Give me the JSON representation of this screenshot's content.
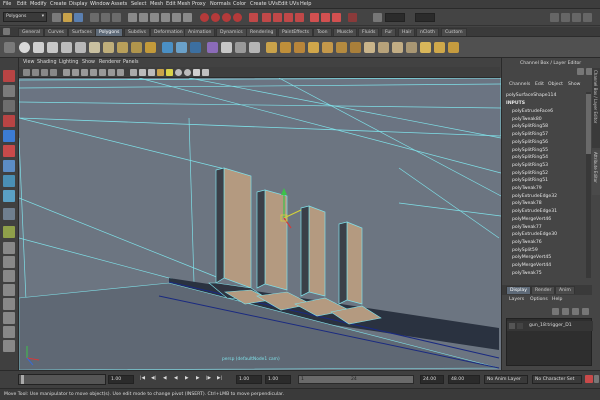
{
  "menubar": {
    "items": [
      "File",
      "Edit",
      "Modify",
      "Create",
      "Display",
      "Window",
      "Assets",
      "Select",
      "Mesh",
      "Edit Mesh",
      "Proxy",
      "Normals",
      "Color",
      "Create UVs",
      "Edit UVs",
      "Help"
    ]
  },
  "statusline": {
    "mode": "Polygons"
  },
  "shelf": {
    "tabs": [
      "General",
      "Curves",
      "Surfaces",
      "Polygons",
      "Subdivs",
      "Deformation",
      "Animation",
      "Dynamics",
      "Rendering",
      "PaintEffects",
      "Toon",
      "Muscle",
      "Fluids",
      "Fur",
      "Hair",
      "nCloth",
      "Custom"
    ],
    "active_tab": "Polygons"
  },
  "viewport": {
    "menus": [
      "View",
      "Shading",
      "Lighting",
      "Show",
      "Renderer",
      "Panels"
    ],
    "camera_label": "persp (defaultNode1 cam)"
  },
  "channel_box": {
    "title": "Channel Box / Layer Editor",
    "menus": [
      "Channels",
      "Edit",
      "Object",
      "Show"
    ],
    "node": "polySurfaceShape114",
    "inputs_label": "INPUTS",
    "items": [
      "polyExtrudeFace6",
      "polyTweak80",
      "polySplitRing58",
      "polySplitRing57",
      "polySplitRing56",
      "polySplitRing55",
      "polySplitRing54",
      "polySplitRing53",
      "polySplitRing52",
      "polySplitRing51",
      "polyTweak79",
      "polyExtrudeEdge32",
      "polyTweak78",
      "polyExtrudeEdge31",
      "polyMergeVert46",
      "polyTweak77",
      "polyExtrudeEdge30",
      "polyTweak76",
      "polySplit59",
      "polyMergeVert45",
      "polyMergeVert44",
      "polyTweak75"
    ],
    "side_tabs": [
      "Attribute Editor",
      "Channel Box / Layer Editor"
    ]
  },
  "layer_editor": {
    "tabs": [
      "Display",
      "Render",
      "Anim"
    ],
    "menus": [
      "Layers",
      "Options",
      "Help"
    ],
    "layer_name": "gun_18:trigger_D1"
  },
  "timeslider": {
    "start": "1.00",
    "current": "1.00",
    "range_start": "1.00",
    "range_end": "24.00",
    "end": "48.00",
    "frame": "1",
    "range_field_value": "24",
    "anim_layer": "No Anim Layer",
    "char_set": "No Character Set",
    "ticks": [
      "1",
      "2",
      "4",
      "6",
      "8",
      "10",
      "12",
      "14",
      "16",
      "18",
      "20",
      "22",
      "24"
    ]
  },
  "helpline": {
    "text": "Move Tool: Use manipulator to move object(s). Use edit mode to change pivot (INSERT). Ctrl+LMB to move perpendicular."
  },
  "colors": {
    "viewport_bg": "#6b7480",
    "wire": "#7fe0e8",
    "face": "#b49a80",
    "selected_row": "#5e6a78"
  }
}
